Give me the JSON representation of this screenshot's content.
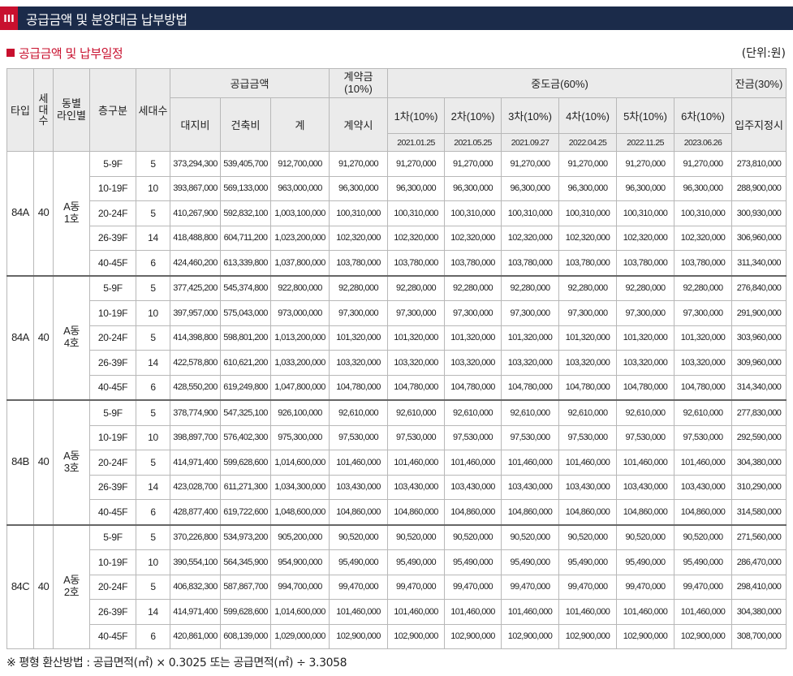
{
  "header": {
    "number": "III",
    "title": "공급금액 및 분양대금 납부방법"
  },
  "subheader": {
    "title": "공급금액 및 납부일정",
    "unit": "(단위:원)"
  },
  "columns": {
    "type": "타입",
    "households_v": "세\n대\n수",
    "line": "동별\n라인별",
    "floor": "층구분",
    "count": "세대수",
    "supply": "공급금액",
    "land": "대지비",
    "building": "건축비",
    "total": "계",
    "deposit": "계약금\n(10%)",
    "deposit_when": "계약시",
    "middle": "중도금(60%)",
    "installments": [
      {
        "label": "1차(10%)",
        "date": "2021.01.25"
      },
      {
        "label": "2차(10%)",
        "date": "2021.05.25"
      },
      {
        "label": "3차(10%)",
        "date": "2021.09.27"
      },
      {
        "label": "4차(10%)",
        "date": "2022.04.25"
      },
      {
        "label": "5차(10%)",
        "date": "2022.11.25"
      },
      {
        "label": "6차(10%)",
        "date": "2023.06.26"
      }
    ],
    "balance": "잔금(30%)",
    "balance_when": "입주지정시"
  },
  "groups": [
    {
      "type": "84A",
      "households": "40",
      "line": "A동\n1호",
      "rows": [
        {
          "floor": "5-9F",
          "count": "5",
          "land": "373,294,300",
          "building": "539,405,700",
          "total": "912,700,000",
          "deposit": "91,270,000",
          "mid": "91,270,000",
          "balance": "273,810,000"
        },
        {
          "floor": "10-19F",
          "count": "10",
          "land": "393,867,000",
          "building": "569,133,000",
          "total": "963,000,000",
          "deposit": "96,300,000",
          "mid": "96,300,000",
          "balance": "288,900,000"
        },
        {
          "floor": "20-24F",
          "count": "5",
          "land": "410,267,900",
          "building": "592,832,100",
          "total": "1,003,100,000",
          "deposit": "100,310,000",
          "mid": "100,310,000",
          "balance": "300,930,000"
        },
        {
          "floor": "26-39F",
          "count": "14",
          "land": "418,488,800",
          "building": "604,711,200",
          "total": "1,023,200,000",
          "deposit": "102,320,000",
          "mid": "102,320,000",
          "balance": "306,960,000"
        },
        {
          "floor": "40-45F",
          "count": "6",
          "land": "424,460,200",
          "building": "613,339,800",
          "total": "1,037,800,000",
          "deposit": "103,780,000",
          "mid": "103,780,000",
          "balance": "311,340,000"
        }
      ]
    },
    {
      "type": "84A",
      "households": "40",
      "line": "A동\n4호",
      "rows": [
        {
          "floor": "5-9F",
          "count": "5",
          "land": "377,425,200",
          "building": "545,374,800",
          "total": "922,800,000",
          "deposit": "92,280,000",
          "mid": "92,280,000",
          "balance": "276,840,000"
        },
        {
          "floor": "10-19F",
          "count": "10",
          "land": "397,957,000",
          "building": "575,043,000",
          "total": "973,000,000",
          "deposit": "97,300,000",
          "mid": "97,300,000",
          "balance": "291,900,000"
        },
        {
          "floor": "20-24F",
          "count": "5",
          "land": "414,398,800",
          "building": "598,801,200",
          "total": "1,013,200,000",
          "deposit": "101,320,000",
          "mid": "101,320,000",
          "balance": "303,960,000"
        },
        {
          "floor": "26-39F",
          "count": "14",
          "land": "422,578,800",
          "building": "610,621,200",
          "total": "1,033,200,000",
          "deposit": "103,320,000",
          "mid": "103,320,000",
          "balance": "309,960,000"
        },
        {
          "floor": "40-45F",
          "count": "6",
          "land": "428,550,200",
          "building": "619,249,800",
          "total": "1,047,800,000",
          "deposit": "104,780,000",
          "mid": "104,780,000",
          "balance": "314,340,000"
        }
      ]
    },
    {
      "type": "84B",
      "households": "40",
      "line": "A동\n3호",
      "rows": [
        {
          "floor": "5-9F",
          "count": "5",
          "land": "378,774,900",
          "building": "547,325,100",
          "total": "926,100,000",
          "deposit": "92,610,000",
          "mid": "92,610,000",
          "balance": "277,830,000"
        },
        {
          "floor": "10-19F",
          "count": "10",
          "land": "398,897,700",
          "building": "576,402,300",
          "total": "975,300,000",
          "deposit": "97,530,000",
          "mid": "97,530,000",
          "balance": "292,590,000"
        },
        {
          "floor": "20-24F",
          "count": "5",
          "land": "414,971,400",
          "building": "599,628,600",
          "total": "1,014,600,000",
          "deposit": "101,460,000",
          "mid": "101,460,000",
          "balance": "304,380,000"
        },
        {
          "floor": "26-39F",
          "count": "14",
          "land": "423,028,700",
          "building": "611,271,300",
          "total": "1,034,300,000",
          "deposit": "103,430,000",
          "mid": "103,430,000",
          "balance": "310,290,000"
        },
        {
          "floor": "40-45F",
          "count": "6",
          "land": "428,877,400",
          "building": "619,722,600",
          "total": "1,048,600,000",
          "deposit": "104,860,000",
          "mid": "104,860,000",
          "balance": "314,580,000"
        }
      ]
    },
    {
      "type": "84C",
      "households": "40",
      "line": "A동\n2호",
      "rows": [
        {
          "floor": "5-9F",
          "count": "5",
          "land": "370,226,800",
          "building": "534,973,200",
          "total": "905,200,000",
          "deposit": "90,520,000",
          "mid": "90,520,000",
          "balance": "271,560,000"
        },
        {
          "floor": "10-19F",
          "count": "10",
          "land": "390,554,100",
          "building": "564,345,900",
          "total": "954,900,000",
          "deposit": "95,490,000",
          "mid": "95,490,000",
          "balance": "286,470,000"
        },
        {
          "floor": "20-24F",
          "count": "5",
          "land": "406,832,300",
          "building": "587,867,700",
          "total": "994,700,000",
          "deposit": "99,470,000",
          "mid": "99,470,000",
          "balance": "298,410,000"
        },
        {
          "floor": "26-39F",
          "count": "14",
          "land": "414,971,400",
          "building": "599,628,600",
          "total": "1,014,600,000",
          "deposit": "101,460,000",
          "mid": "101,460,000",
          "balance": "304,380,000"
        },
        {
          "floor": "40-45F",
          "count": "6",
          "land": "420,861,000",
          "building": "608,139,000",
          "total": "1,029,000,000",
          "deposit": "102,900,000",
          "mid": "102,900,000",
          "balance": "308,700,000"
        }
      ]
    }
  ],
  "footnote": "※ 평형 환산방법 : 공급면적(㎡) × 0.3025 또는 공급면적(㎡) ÷ 3.3058"
}
